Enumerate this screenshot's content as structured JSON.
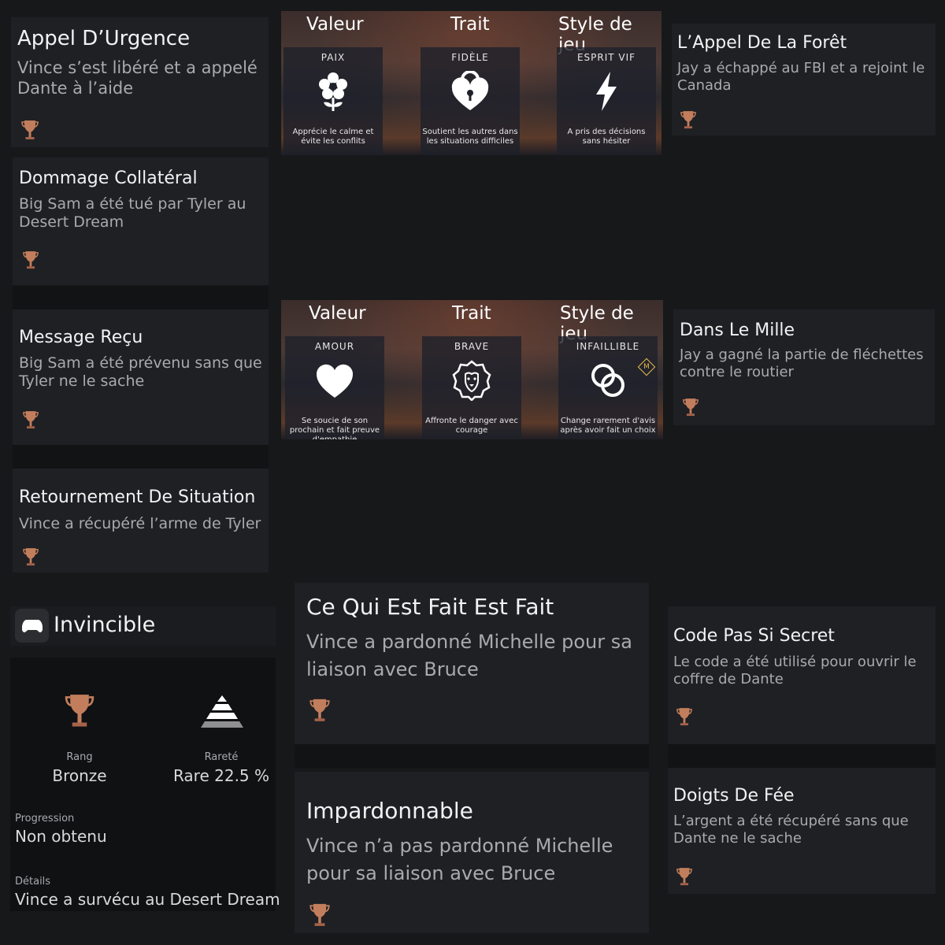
{
  "trophies": [
    {
      "title": "Appel D’Urgence",
      "desc": "Vince s’est libéré et a appelé Dante à l’aide"
    },
    {
      "title": "Dommage Collatéral",
      "desc": "Big Sam a été tué par Tyler au Desert Dream"
    },
    {
      "title": "Message Reçu",
      "desc": "Big Sam a été prévenu sans que Tyler ne le sache"
    },
    {
      "title": "Retournement De Situation",
      "desc": "Vince a récupéré l’arme de Tyler"
    },
    {
      "title": "L’Appel De La Forêt",
      "desc": "Jay a échappé au FBI et a rejoint le Canada"
    },
    {
      "title": "Dans Le Mille",
      "desc": "Jay a gagné la partie de fléchettes contre le routier"
    },
    {
      "title": "Ce Qui Est Fait Est Fait",
      "desc": "Vince a pardonné Michelle pour sa liaison avec Bruce"
    },
    {
      "title": "Impardonnable",
      "desc": "Vince n’a pas pardonné Michelle pour sa liaison avec Bruce"
    },
    {
      "title": "Code Pas Si Secret",
      "desc": "Le code a été utilisé pour ouvrir le coffre de Dante"
    },
    {
      "title": "Doigts De Fée",
      "desc": "L’argent a été récupéré sans que Dante ne le sache"
    }
  ],
  "personality_panels": [
    {
      "headers": [
        "Valeur",
        "Trait",
        "Style de jeu"
      ],
      "cells": [
        {
          "label": "PAIX",
          "icon": "flower-icon",
          "caption": "Apprécie le calme et évite les conflits"
        },
        {
          "label": "FIDÈLE",
          "icon": "heart-lock-icon",
          "caption": "Soutient les autres dans les situations difficiles"
        },
        {
          "label": "ESPRIT VIF",
          "icon": "lightning-icon",
          "caption": "A pris des décisions sans hésiter"
        }
      ]
    },
    {
      "headers": [
        "Valeur",
        "Trait",
        "Style de jeu"
      ],
      "cells": [
        {
          "label": "AMOUR",
          "icon": "heart-icon",
          "caption": "Se soucie de son prochain et fait preuve d'empathie"
        },
        {
          "label": "BRAVE",
          "icon": "lion-icon",
          "caption": "Affronte le danger avec courage"
        },
        {
          "label": "INFAILLIBLE",
          "icon": "rings-icon",
          "badge": "M",
          "caption": "Change rarement d'avis après avoir fait un choix"
        }
      ]
    }
  ],
  "invincible": {
    "title": "Invincible",
    "rank_label": "Rang",
    "rank_value": "Bronze",
    "rarity_label": "Rareté",
    "rarity_value": "Rare 22.5 %",
    "progress_label": "Progression",
    "progress_value": "Non obtenu",
    "details_label": "Détails",
    "details_value": "Vince a survécu au Desert Dream"
  },
  "colors": {
    "background": "#17181a",
    "card": "#1f2024",
    "bronze": "#c27e5c",
    "title_text": "#f2f2f2",
    "desc_text": "#a9aaad"
  }
}
